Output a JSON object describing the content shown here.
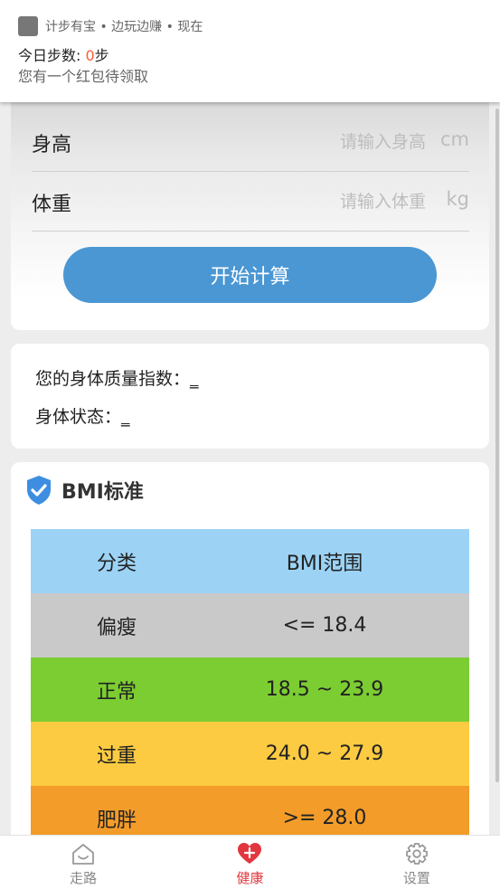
{
  "notification": {
    "header": "计步有宝 • 边玩边赚 • 现在",
    "title_prefix": "今日步数: ",
    "steps": "0",
    "title_suffix": "步",
    "body": "您有一个红包待领取"
  },
  "form": {
    "height_label": "身高",
    "height_placeholder": "请输入身高",
    "height_unit": "cm",
    "weight_label": "体重",
    "weight_placeholder": "请输入体重",
    "weight_unit": "kg",
    "calc_button": "开始计算"
  },
  "result": {
    "bmi_label": "您的身体质量指数：",
    "bmi_value": "_",
    "status_label": "身体状态：",
    "status_value": "_"
  },
  "bmi_standard": {
    "title": "BMI标准",
    "header": {
      "category": "分类",
      "range": "BMI范围",
      "color": "#9cd3f5"
    },
    "rows": [
      {
        "category": "偏瘦",
        "range": "<= 18.4",
        "color": "#c9c9c9"
      },
      {
        "category": "正常",
        "range": "18.5 ~ 23.9",
        "color": "#7ccd32"
      },
      {
        "category": "过重",
        "range": "24.0 ~ 27.9",
        "color": "#fccb41"
      },
      {
        "category": "肥胖",
        "range": ">= 28.0",
        "color": "#f39c2a"
      }
    ]
  },
  "tabs": [
    {
      "label": "走路",
      "icon": "home-face-icon",
      "active": false
    },
    {
      "label": "健康",
      "icon": "heart-plus-icon",
      "active": true
    },
    {
      "label": "设置",
      "icon": "gear-icon",
      "active": false
    }
  ],
  "colors": {
    "accent_blue": "#4a97d4",
    "accent_red": "#e2363f",
    "shield_blue": "#3d8ee0"
  }
}
